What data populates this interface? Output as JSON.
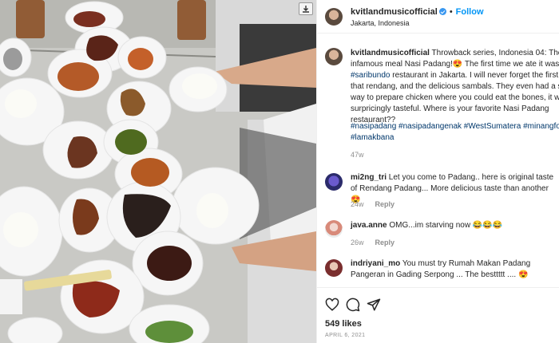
{
  "post": {
    "account": "kvitlandmusicofficial",
    "separator": "•",
    "follow_label": "Follow",
    "location": "Jakarta, Indonesia"
  },
  "caption": {
    "user": "kvitlandmusicofficial",
    "text_1": "Throwback series, Indonesia 04: The infamous meal Nasi Padang!😍 The first time we ate it was in ",
    "mention": "#saribundo",
    "text_2": " restaurant in Jakarta. I will never forget the first bite of that rendang, and the delicious sambals. They even had a special way to prepare chicken where you could eat the bones, it was surpricingly tasteful. Where is your favorite Nasi Padang restaurant??",
    "hashtags": "#nasipadang #nasipadangenak #WestSumatera #minangfood #lamakbana",
    "age": "47w"
  },
  "comments": [
    {
      "user": "mi2ng_tri",
      "text": "Let you come to Padang.. here is original taste of Rendang Padang... More delicious taste than another 😍",
      "age": "24w",
      "reply_label": "Reply"
    },
    {
      "user": "java.anne",
      "text": "OMG...im starving now 😂😂😂",
      "age": "26w",
      "reply_label": "Reply"
    },
    {
      "user": "indriyani_mo",
      "text": "You must try Rumah Makan Padang Pangeran in Gading Serpong ... The besttttt .... 😍"
    }
  ],
  "footer": {
    "likes": "549 likes",
    "date": "APRIL 6, 2021"
  },
  "icons": {
    "verified": "verified-badge-icon",
    "like": "heart-icon",
    "comment": "comment-bubble-icon",
    "share": "paper-plane-icon",
    "download": "download-icon"
  },
  "colors": {
    "link": "#00376b",
    "follow": "#0095f6",
    "muted": "#8e8e8e",
    "verified": "#3897f0"
  }
}
